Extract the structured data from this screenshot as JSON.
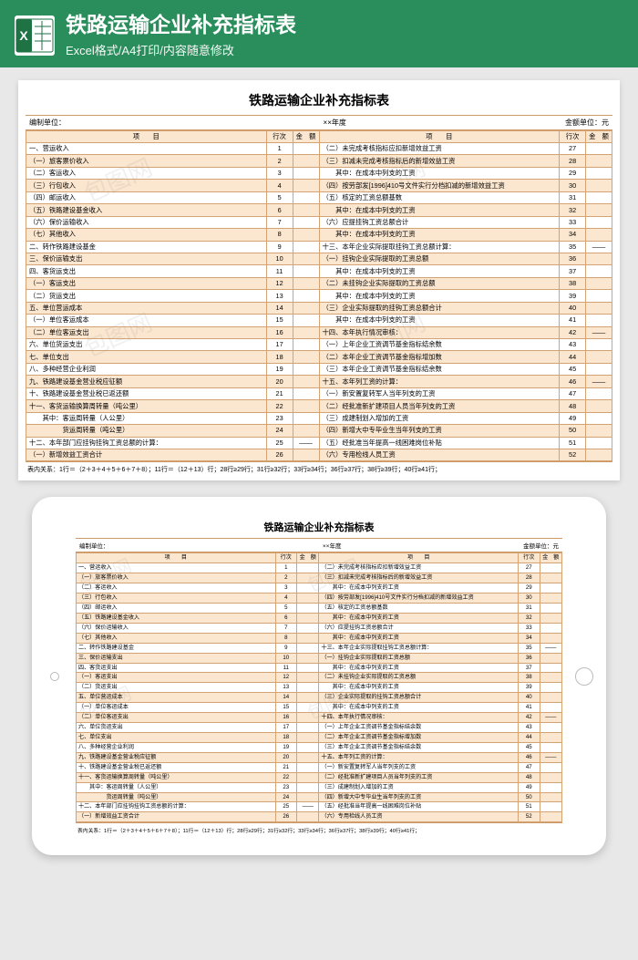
{
  "header": {
    "title": "铁路运输企业补充指标表",
    "subtitle": "Excel格式/A4打印/内容随意修改"
  },
  "sheet": {
    "title": "铁路运输企业补充指标表",
    "meta_left": "编制单位：",
    "meta_center": "××年度",
    "meta_right": "金额单位：元",
    "th_item": "项　　目",
    "th_row": "行次",
    "th_amt": "金　额",
    "footnote": "表内关系：1行＝（2＋3＋4＋5＋6＋7＋8）；11行＝（12＋13）行；28行≥29行；31行≥32行；33行≥34行；36行≥37行；38行≥39行；40行≥41行；"
  },
  "left_rows": [
    {
      "item": "一、营运收入",
      "row": "1"
    },
    {
      "item": "（一）旅客票价收入",
      "row": "2"
    },
    {
      "item": "（二）客运收入",
      "row": "3"
    },
    {
      "item": "（三）行包收入",
      "row": "4"
    },
    {
      "item": "（四）邮运收入",
      "row": "5"
    },
    {
      "item": "（五）铁路建设基金收入",
      "row": "6"
    },
    {
      "item": "（六）保价运输收入",
      "row": "7"
    },
    {
      "item": "（七）其他收入",
      "row": "8"
    },
    {
      "item": "二、转作铁路建设基金",
      "row": "9"
    },
    {
      "item": "三、保价运输支出",
      "row": "10"
    },
    {
      "item": "四、客货运支出",
      "row": "11"
    },
    {
      "item": "（一）客运支出",
      "row": "12"
    },
    {
      "item": "（二）货运支出",
      "row": "13"
    },
    {
      "item": "五、单位营运成本",
      "row": "14"
    },
    {
      "item": "（一）单位客运成本",
      "row": "15"
    },
    {
      "item": "（二）单位客运支出",
      "row": "16"
    },
    {
      "item": "六、单位货运支出",
      "row": "17"
    },
    {
      "item": "七、单位支出",
      "row": "18"
    },
    {
      "item": "八、多种经营企业利润",
      "row": "19"
    },
    {
      "item": "九、铁路建设基金营业税应征额",
      "row": "20"
    },
    {
      "item": "十、铁路建设基金营业税已返还额",
      "row": "21"
    },
    {
      "item": "十一、客货运输换算周转量（吨公里）",
      "row": "22"
    },
    {
      "item": "　　其中：客运周转量（人公里）",
      "row": "23"
    },
    {
      "item": "　　　　　货运周转量（吨公里）",
      "row": "24"
    },
    {
      "item": "十二、本年部门应挂钩挂钩工资总额的计算：",
      "row": "25",
      "amt": "——"
    },
    {
      "item": "（一）新增效益工资合计",
      "row": "26"
    }
  ],
  "right_rows": [
    {
      "item": "（二）未完成考核指标应扣新增效益工资",
      "row": "27"
    },
    {
      "item": "（三）扣减未完成考核指标后的新增效益工资",
      "row": "28"
    },
    {
      "item": "　　其中：在成本中列支的工资",
      "row": "29"
    },
    {
      "item": "（四）按劳部发[1996]410号文件实行分档扣减的新增效益工资",
      "row": "30"
    },
    {
      "item": "（五）核定的工资总额基数",
      "row": "31"
    },
    {
      "item": "　　其中：在成本中列支的工资",
      "row": "32"
    },
    {
      "item": "（六）应提挂钩工资总额合计",
      "row": "33"
    },
    {
      "item": "　　其中：在成本中列支的工资",
      "row": "34"
    },
    {
      "item": "十三、本年企业实际提取挂钩工资总额计算：",
      "row": "35",
      "amt": "——"
    },
    {
      "item": "（一）挂钩企业实际提取的工资总额",
      "row": "36"
    },
    {
      "item": "　　其中：在成本中列支的工资",
      "row": "37"
    },
    {
      "item": "（二）未挂钩企业实际提取的工资总额",
      "row": "38"
    },
    {
      "item": "　　其中：在成本中列支的工资",
      "row": "39"
    },
    {
      "item": "（三）企业实际提取的挂钩工资总额合计",
      "row": "40"
    },
    {
      "item": "　　其中：在成本中列支的工资",
      "row": "41"
    },
    {
      "item": "十四、本年执行情况审核：",
      "row": "42",
      "amt": "——"
    },
    {
      "item": "（一）上年企业工资调节基金指标结余数",
      "row": "43"
    },
    {
      "item": "（二）本年企业工资调节基金指标增加数",
      "row": "44"
    },
    {
      "item": "（三）本年企业工资调节基金指标结余数",
      "row": "45"
    },
    {
      "item": "十五、本年列工资的计算：",
      "row": "46",
      "amt": "——"
    },
    {
      "item": "（一）新安置复转军人当年列支的工资",
      "row": "47"
    },
    {
      "item": "（二）经批准新扩建项目人员当年列支的工资",
      "row": "48"
    },
    {
      "item": "（三）成建制划入增加的工资",
      "row": "49"
    },
    {
      "item": "（四）新增大中专毕业生当年列支的工资",
      "row": "50"
    },
    {
      "item": "（五）经批准当年提高一线困难岗位补贴",
      "row": "51"
    },
    {
      "item": "（六）专用检线人员工资",
      "row": "52"
    }
  ],
  "watermark": "包图网"
}
